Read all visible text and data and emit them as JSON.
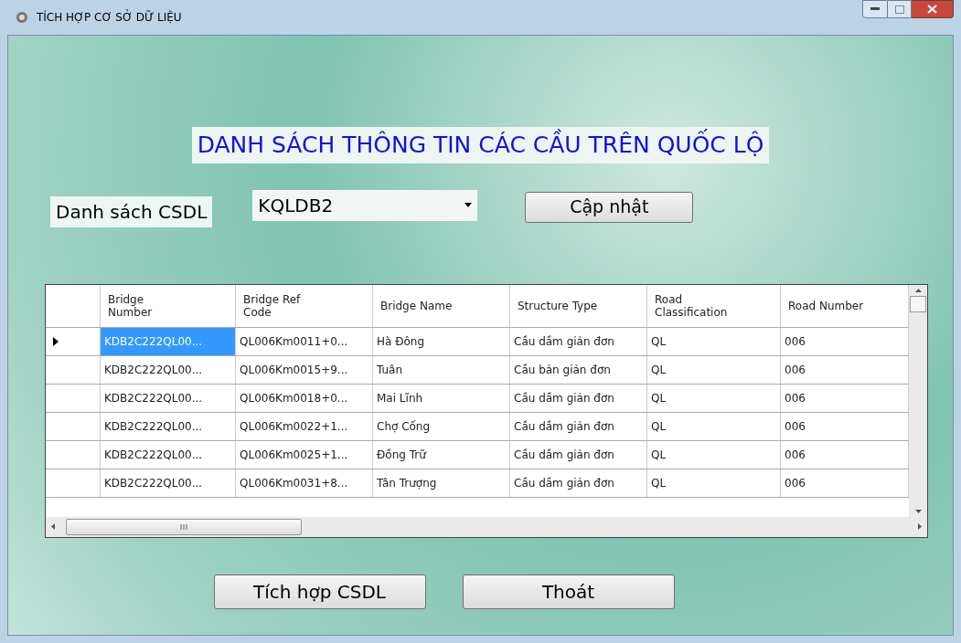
{
  "window": {
    "title": "TÍCH HỢP CƠ SỞ DỮ LIỆU"
  },
  "heading": "DANH SÁCH THÔNG TIN CÁC CẦU TRÊN QUỐC LỘ",
  "database_label": "Danh sách CSDL",
  "database_select": {
    "value": "KQLDB2"
  },
  "update_button": "Cập nhật",
  "table": {
    "columns": [
      "Bridge Number",
      "Bridge Ref Code",
      "Bridge Name",
      "Structure Type",
      "Road Classification",
      "Road Number"
    ],
    "rows": [
      {
        "selected": true,
        "cells": [
          "KDB2C222QL00...",
          "QL006Km0011+0...",
          "Hà Đông",
          "Cầu dầm giản đơn",
          "QL",
          "006"
        ]
      },
      {
        "selected": false,
        "cells": [
          "KDB2C222QL00...",
          "QL006Km0015+9...",
          "Tuân",
          "Cầu bản giản đơn",
          "QL",
          "006"
        ]
      },
      {
        "selected": false,
        "cells": [
          "KDB2C222QL00...",
          "QL006Km0018+0...",
          "Mai Lĩnh",
          "Cầu dầm giản đơn",
          "QL",
          "006"
        ]
      },
      {
        "selected": false,
        "cells": [
          "KDB2C222QL00...",
          "QL006Km0022+1...",
          "Chợ Cống",
          "Cầu dầm giản đơn",
          "QL",
          "006"
        ]
      },
      {
        "selected": false,
        "cells": [
          "KDB2C222QL00...",
          "QL006Km0025+1...",
          "Đồng Trữ",
          "Cầu dầm giản đơn",
          "QL",
          "006"
        ]
      },
      {
        "selected": false,
        "cells": [
          "KDB2C222QL00...",
          "QL006Km0031+8...",
          "Tân Trượng",
          "Cầu dầm giản đơn",
          "QL",
          "006"
        ]
      }
    ]
  },
  "buttons": [
    "Tích hợp CSDL",
    "Thoát"
  ]
}
